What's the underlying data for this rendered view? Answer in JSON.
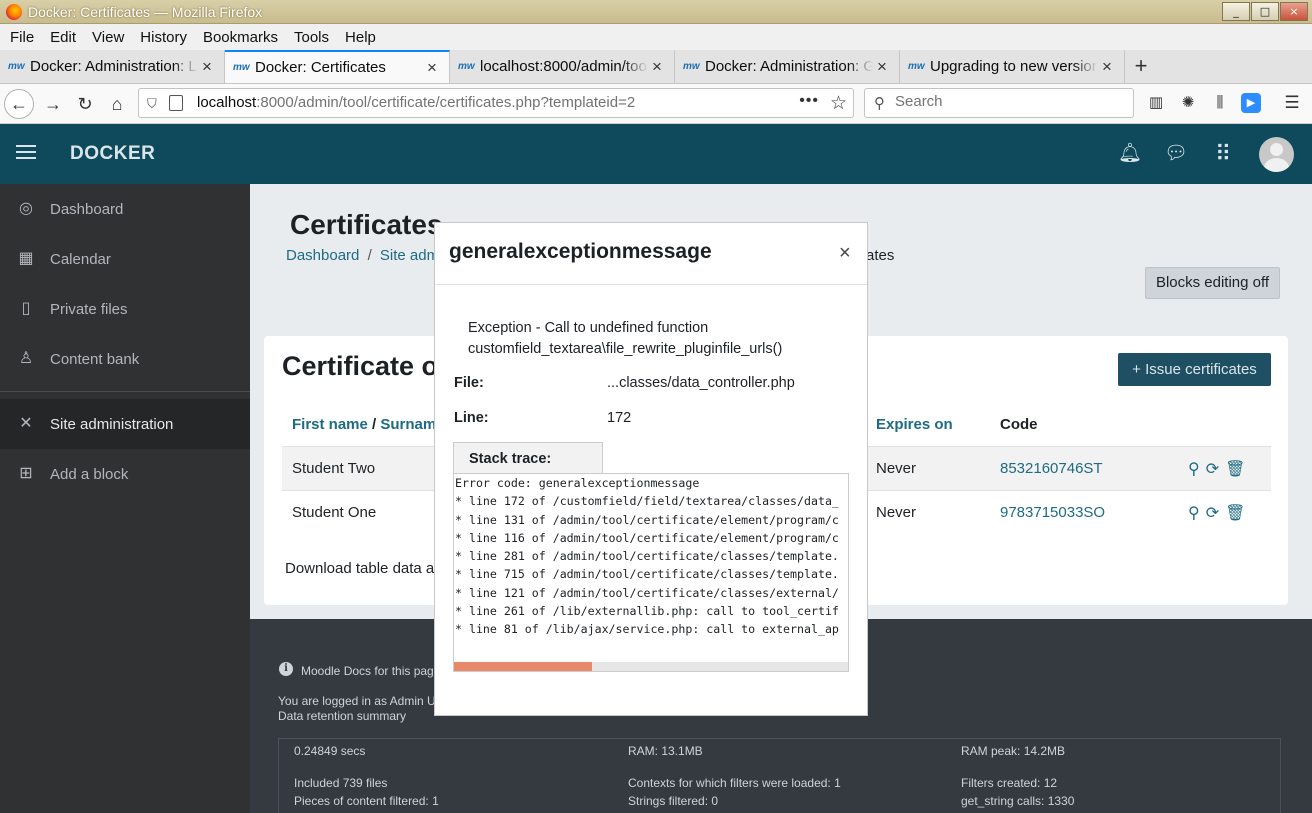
{
  "window": {
    "title": "Docker: Certificates — Mozilla Firefox",
    "buttons": [
      "_",
      "□",
      "×"
    ]
  },
  "menubar": [
    "File",
    "Edit",
    "View",
    "History",
    "Bookmarks",
    "Tools",
    "Help"
  ],
  "tabs": [
    {
      "favicon": "mw",
      "label": "Docker: Administration: L",
      "active": false
    },
    {
      "favicon": "mw",
      "label": "Docker: Certificates",
      "active": true
    },
    {
      "favicon": "mw",
      "label": "localhost:8000/admin/tool",
      "active": false
    },
    {
      "favicon": "mw",
      "label": "Docker: Administration: G",
      "active": false
    },
    {
      "favicon": "mw",
      "label": "Upgrading to new version",
      "active": false
    }
  ],
  "navbar": {
    "url_host": "localhost",
    "url_rest": ":8000/admin/tool/certificate/certificates.php?templateid=2",
    "search_placeholder": "Search"
  },
  "moodle": {
    "brand": "DOCKER",
    "icons": [
      "bell-icon",
      "chat-icon",
      "grid-icon"
    ]
  },
  "sidebar": {
    "items": [
      {
        "label": "Dashboard",
        "icon": "dashboard-icon"
      },
      {
        "label": "Calendar",
        "icon": "calendar-icon"
      },
      {
        "label": "Private files",
        "icon": "file-icon"
      },
      {
        "label": "Content bank",
        "icon": "content-bank-icon"
      },
      {
        "label": "Site administration",
        "icon": "wrench-icon"
      },
      {
        "label": "Add a block",
        "icon": "plus-square-icon"
      }
    ]
  },
  "page": {
    "title": "Certificates",
    "breadcrumb": [
      "Dashboard",
      "/",
      "Site adm",
      "ates"
    ],
    "blocks_editing": "Blocks editing off",
    "card_title": "Certificate o",
    "issue_button": "+ Issue certificates",
    "columns": {
      "first": "First name",
      "slash": " / ",
      "last": "Surnam",
      "expires": "Expires on",
      "code": "Code"
    },
    "rows": [
      {
        "name": "Student Two",
        "expires": "Never",
        "code": "8532160746ST"
      },
      {
        "name": "Student One",
        "expires": "Never",
        "code": "9783715033SO"
      }
    ],
    "download": "Download table data as"
  },
  "footer": {
    "docs_link": "Moodle Docs for this page",
    "logged_prefix": "You are logged in as ",
    "logged_user": "Admin Us",
    "retention": "Data retention summary",
    "perf": {
      "secs": "0.24849 secs",
      "ram": "RAM: 13.1MB",
      "ram_peak": "RAM peak: 14.2MB",
      "included": "Included 739 files",
      "contexts": "Contexts for which filters were loaded: 1",
      "filters_created": "Filters created: 12",
      "pieces": "Pieces of content filtered: 1",
      "strings": "Strings filtered: 0",
      "get_string": "get_string calls: 1330"
    }
  },
  "modal": {
    "title": "generalexceptionmessage",
    "close": "×",
    "exception_line1": "Exception - Call to undefined function",
    "exception_line2": "customfield_textarea\\file_rewrite_pluginfile_urls()",
    "file_label": "File:",
    "file_value": "...classes/data_controller.php",
    "line_label": "Line:",
    "line_value": "172",
    "stack_label": "Stack trace:",
    "stack": [
      "Error code: generalexceptionmessage",
      "* line 172 of /customfield/field/textarea/classes/data_",
      "* line 131 of /admin/tool/certificate/element/program/c",
      "* line 116 of /admin/tool/certificate/element/program/c",
      "* line 281 of /admin/tool/certificate/classes/template.",
      "* line 715 of /admin/tool/certificate/classes/template.",
      "* line 121 of /admin/tool/certificate/classes/external/",
      "* line 261 of /lib/externallib.php: call to tool_certif",
      "* line 81 of /lib/ajax/service.php: call to external_ap"
    ],
    "scroll_fraction": 0.35
  }
}
